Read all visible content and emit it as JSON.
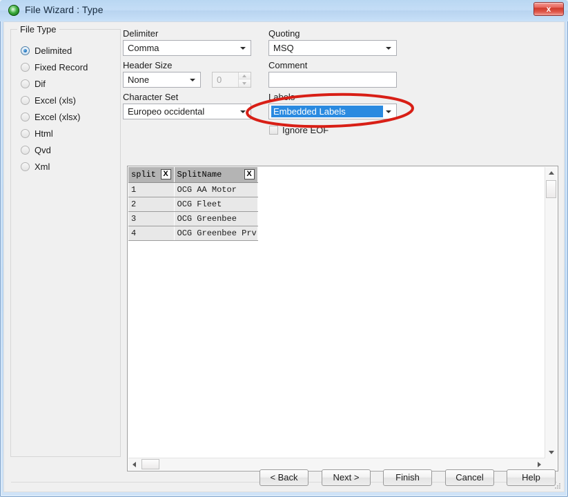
{
  "window": {
    "title": "File Wizard : Type",
    "icon": "app-globe-icon",
    "close_label": "x"
  },
  "file_type": {
    "legend": "File Type",
    "options": [
      {
        "label": "Delimited",
        "selected": true
      },
      {
        "label": "Fixed Record",
        "selected": false
      },
      {
        "label": "Dif",
        "selected": false
      },
      {
        "label": "Excel (xls)",
        "selected": false
      },
      {
        "label": "Excel (xlsx)",
        "selected": false
      },
      {
        "label": "Html",
        "selected": false
      },
      {
        "label": "Qvd",
        "selected": false
      },
      {
        "label": "Xml",
        "selected": false
      }
    ]
  },
  "delimiter": {
    "label": "Delimiter",
    "value": "Comma"
  },
  "header_size": {
    "label": "Header Size",
    "value": "None",
    "spinner_value": "0",
    "spinner_enabled": false
  },
  "character_set": {
    "label": "Character Set",
    "value": "Europeo occidental"
  },
  "quoting": {
    "label": "Quoting",
    "value": "MSQ"
  },
  "comment": {
    "label": "Comment",
    "value": "",
    "placeholder": ""
  },
  "labels": {
    "label": "Labels",
    "value": "Embedded Labels",
    "highlight_color": "#2a8ae0",
    "highlighted": true
  },
  "ignore_eof": {
    "label": "Ignore EOF",
    "checked": false
  },
  "preview": {
    "columns": [
      {
        "name": "split",
        "delete_label": "X"
      },
      {
        "name": "SplitName",
        "delete_label": "X"
      }
    ],
    "rows": [
      [
        "1",
        "OCG AA Motor"
      ],
      [
        "2",
        "OCG Fleet"
      ],
      [
        "3",
        "OCG Greenbee"
      ],
      [
        "4",
        "OCG Greenbee Prv"
      ]
    ]
  },
  "buttons": {
    "back": "< Back",
    "next": "Next >",
    "finish": "Finish",
    "cancel": "Cancel",
    "help": "Help"
  },
  "annotation": {
    "shape": "ellipse",
    "color": "#d81f16",
    "target": "labels-combo"
  }
}
